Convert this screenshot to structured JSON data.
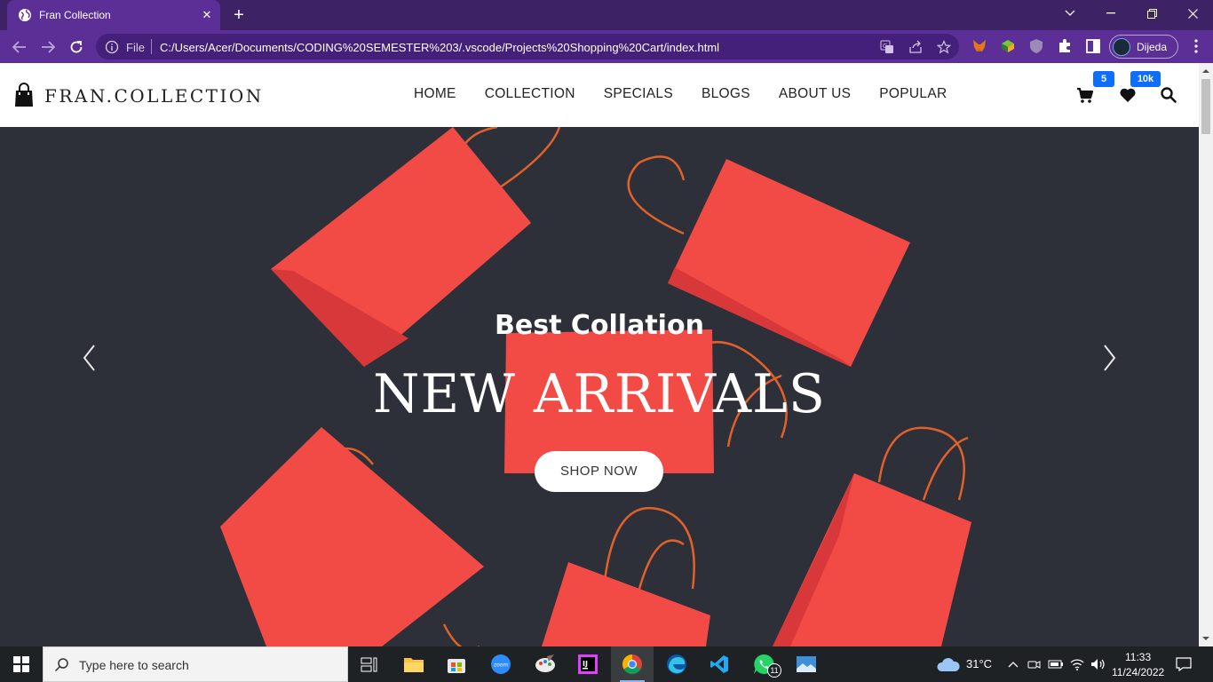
{
  "browser": {
    "tab_title": "Fran Collection",
    "omnibox_scheme": "File",
    "url": "C:/Users/Acer/Documents/CODING%20SEMESTER%203/.vscode/Projects%20Shopping%20Cart/index.html",
    "profile_name": "Dijeda"
  },
  "site": {
    "logo_text": "FRAN.COLLECTION",
    "nav": [
      "HOME",
      "COLLECTION",
      "SPECIALS",
      "BLOGS",
      "ABOUT US",
      "POPULAR"
    ],
    "cart_count": "5",
    "wishlist_count": "10k"
  },
  "hero": {
    "subtitle": "Best Collation",
    "title": "NEW ARRIVALS",
    "button": "SHOP NOW"
  },
  "taskbar": {
    "search_placeholder": "Type here to search",
    "weather": "31°C",
    "time": "11:33",
    "date": "11/24/2022",
    "whatsapp_badge": "11"
  },
  "colors": {
    "chrome_tabstrip": "#3d2266",
    "chrome_toolbar": "#5b2f96",
    "badge": "#0d6efd",
    "bag_red": "#f24b46",
    "hero_bg": "#2e3039"
  }
}
